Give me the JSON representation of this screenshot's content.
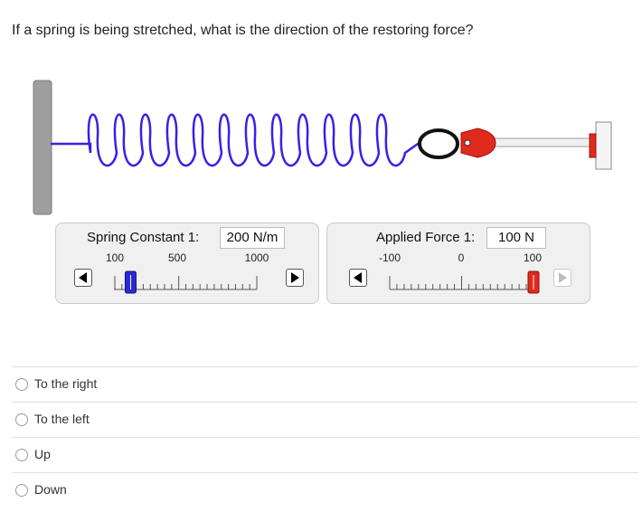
{
  "question": "If a spring is being stretched, what is the direction of the restoring force?",
  "spring_panel": {
    "title": "Spring Constant 1:",
    "value": "200 N/m",
    "tick_labels": [
      "100",
      "500",
      "1000"
    ],
    "slider_level": 200,
    "range": [
      100,
      1000
    ]
  },
  "force_panel": {
    "title": "Applied Force 1:",
    "value": "100 N",
    "tick_labels": [
      "-100",
      "0",
      "100"
    ],
    "slider_level": 100,
    "range": [
      -100,
      100
    ]
  },
  "colors": {
    "spring": "#3b1fe8",
    "spring_thumb": "#2929d6",
    "force_thumb": "#e02a1c",
    "wall": "#9e9e9e"
  },
  "options": [
    {
      "label": "To the right"
    },
    {
      "label": "To the left"
    },
    {
      "label": "Up"
    },
    {
      "label": "Down"
    }
  ]
}
